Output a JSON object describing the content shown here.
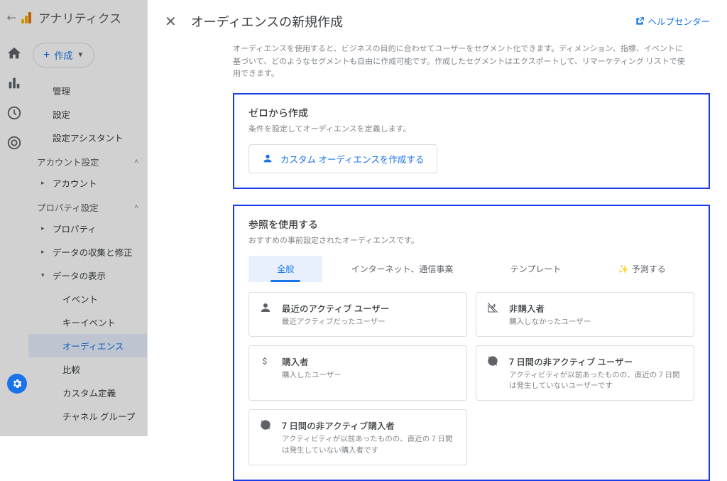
{
  "header": {
    "product": "アナリティクス"
  },
  "sidebar": {
    "create_label": "作成",
    "admin_items": [
      "管理",
      "設定",
      "設定アシスタント"
    ],
    "account_section": "アカウント設定",
    "account_items": [
      "アカウント"
    ],
    "property_section": "プロパティ設定",
    "property_items": [
      "プロパティ",
      "データの収集と修正"
    ],
    "data_display_item": "データの表示",
    "data_display_children": [
      "イベント",
      "キーイベント",
      "オーディエンス",
      "比較",
      "カスタム定義",
      "チャネル グループ"
    ],
    "selected_child_index": 2
  },
  "modal": {
    "title": "オーディエンスの新規作成",
    "help_label": "ヘルプセンター",
    "intro": "オーディエンスを使用すると、ビジネスの目的に合わせてユーザーをセグメント化できます。ディメンション、指標、イベントに基づいて、どのようなセグメントも自由に作成可能です。作成したセグメントはエクスポートして、リマーケティング リストで使用できます。",
    "scratch": {
      "title": "ゼロから作成",
      "subtitle": "条件を設定してオーディエンスを定義します。",
      "button": "カスタム オーディエンスを作成する"
    },
    "reference": {
      "title": "参照を使用する",
      "subtitle": "おすすめの事前設定されたオーディエンスです。",
      "tabs": [
        "全般",
        "インターネット、通信事業",
        "テンプレート",
        "予測する"
      ],
      "active_tab": 0,
      "templates": [
        {
          "icon": "person",
          "title": "最近のアクティブ ユーザー",
          "desc": "最近アクティブだったユーザー"
        },
        {
          "icon": "person-off",
          "title": "非購入者",
          "desc": "購入しなかったユーザー"
        },
        {
          "icon": "dollar",
          "title": "購入者",
          "desc": "購入したユーザー"
        },
        {
          "icon": "clock-off",
          "title": "7 日間の非アクティブ ユーザー",
          "desc": "アクティビティが以前あったものの、直近の 7 日間は発生していないユーザーです"
        },
        {
          "icon": "clock-off",
          "title": "7 日間の非アクティブ購入者",
          "desc": "アクティビティが以前あったものの、直近の 7 日間は発生していない購入者です"
        }
      ]
    }
  }
}
